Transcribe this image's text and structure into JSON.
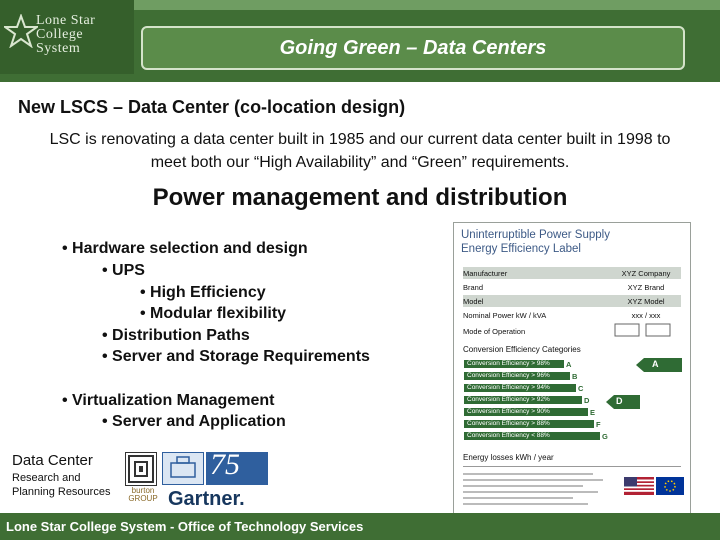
{
  "header": {
    "logo_lines": [
      "Lone Star",
      "College",
      "System"
    ],
    "title": "Going Green – Data Centers"
  },
  "subtitle": "New LSCS – Data Center (co-location design)",
  "intro": "LSC is renovating a data center built in 1985 and our current data center built in 1998 to meet both our “High Availability” and “Green” requirements.",
  "section_heading": "Power management and distribution",
  "bullets": [
    "• Hardware selection and design",
    "• UPS",
    "• High Efficiency",
    "• Modular flexibility",
    "• Distribution Paths",
    "• Server and Storage Requirements",
    "• Virtualization Management",
    "• Server and Application"
  ],
  "label": {
    "title1": "Uninterruptible Power Supply",
    "title2": "Energy Efficiency Label",
    "rows": [
      {
        "k": "Manufacturer",
        "v": "XYZ Company"
      },
      {
        "k": "Brand",
        "v": "XYZ Brand"
      },
      {
        "k": "Model",
        "v": "XYZ Model"
      },
      {
        "k": "Nominal Power kW / kVA",
        "v": "xxx / xxx"
      },
      {
        "k": "Mode of Operation",
        "v": ""
      }
    ],
    "categories_title": "Conversion Efficiency Categories",
    "bars": [
      {
        "text": "Conversion Efficiency > 98%",
        "grade": "A"
      },
      {
        "text": "Conversion Efficiency > 96%",
        "grade": "B"
      },
      {
        "text": "Conversion Efficiency > 94%",
        "grade": "C"
      },
      {
        "text": "Conversion Efficiency > 92%",
        "grade": "D"
      },
      {
        "text": "Conversion Efficiency > 90%",
        "grade": "E"
      },
      {
        "text": "Conversion Efficiency > 88%",
        "grade": "F"
      },
      {
        "text": "Conversion Efficiency < 88%",
        "grade": "G"
      }
    ],
    "marker_a": "A",
    "marker_d": "D",
    "energy_losses": "Energy losses kWh / year"
  },
  "resources": {
    "title": "Data Center",
    "research_line1": "Research and",
    "research_line2": "Planning Resources",
    "burton_line1": "burton",
    "burton_line2": "GROUP",
    "anniv_number": "75",
    "gartner": "Gartner."
  },
  "footer": "Lone Star College System - Office of Technology Services"
}
